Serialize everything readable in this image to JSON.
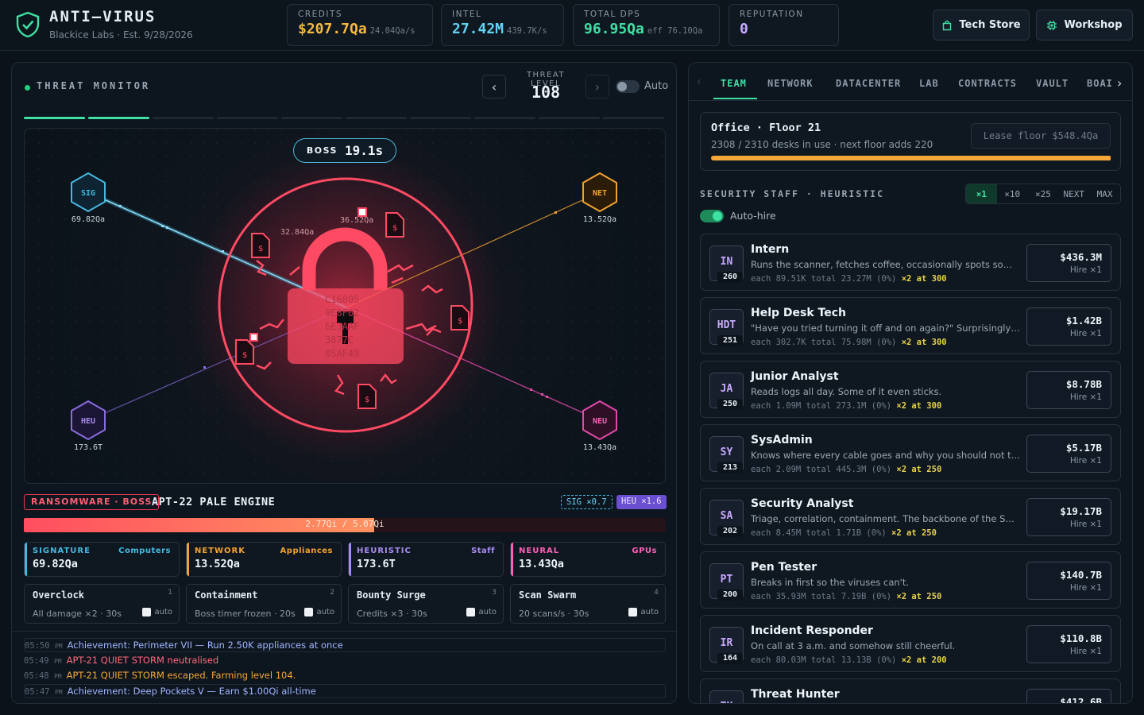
{
  "header": {
    "title": "ANTI–VIRUS",
    "subtitle": "Blackice Labs · Est. 9/28/2026",
    "stats": [
      {
        "label": "CREDITS",
        "value": "$207.7Qa",
        "rate": "24.04Qa/s",
        "color": "#f5b942"
      },
      {
        "label": "INTEL",
        "value": "27.42M",
        "rate": "439.7K/s",
        "color": "#64d2f2"
      },
      {
        "label": "TOTAL DPS",
        "value": "96.95Qa",
        "rate": "eff 76.10Qa",
        "color": "#3fe0a3"
      },
      {
        "label": "REPUTATION",
        "value": "0",
        "rate": "",
        "color": "#c8a8ff"
      }
    ],
    "buttons": {
      "tech_store": "Tech Store",
      "workshop": "Workshop"
    }
  },
  "threat": {
    "title": "THREAT MONITOR",
    "level_label": "THREAT LEVEL",
    "level": "108",
    "auto_label": "Auto",
    "progress_filled_segments": 2,
    "progress_total_segments": 10,
    "boss_label": "BOSS",
    "boss_timer": "19.1s",
    "damage_floaters": [
      "32.84Qa",
      "36.52Qa"
    ],
    "hex_nodes": [
      {
        "id": "SIG",
        "value": "69.82Qa",
        "color": "#46b8e0"
      },
      {
        "id": "NET",
        "value": "13.52Qa",
        "color": "#f2a230"
      },
      {
        "id": "HEU",
        "value": "173.6T",
        "color": "#8a6ce0"
      },
      {
        "id": "NEU",
        "value": "13.43Qa",
        "color": "#e04aa8"
      }
    ],
    "lock_hex": [
      "C16805",
      "9E8F02",
      "6E3AAF",
      "3877C",
      "05AF49"
    ],
    "enemy_tag": "RANSOMWARE · BOSS",
    "enemy_name": "APT-22 PALE ENGINE",
    "mult_sig": "SIG ×0.7",
    "mult_heu": "HEU ×1.6",
    "hp_text": "2.77Qi / 5.07Qi",
    "hp_fraction": 0.546
  },
  "damage_cards": [
    {
      "title": "SIGNATURE",
      "source": "Computers",
      "value": "69.82Qa",
      "color": "#46b8e0"
    },
    {
      "title": "NETWORK",
      "source": "Appliances",
      "value": "13.52Qa",
      "color": "#f2a230"
    },
    {
      "title": "HEURISTIC",
      "source": "Staff",
      "value": "173.6T",
      "color": "#a98cf0"
    },
    {
      "title": "NEURAL",
      "source": "GPUs",
      "value": "13.43Qa",
      "color": "#ff5fb8"
    }
  ],
  "abilities": [
    {
      "name": "Overclock",
      "key": "1",
      "desc": "All damage ×2 · 30s",
      "auto": "auto"
    },
    {
      "name": "Containment",
      "key": "2",
      "desc": "Boss timer frozen · 20s",
      "auto": "auto"
    },
    {
      "name": "Bounty Surge",
      "key": "3",
      "desc": "Credits ×3 · 30s",
      "auto": "auto"
    },
    {
      "name": "Scan Swarm",
      "key": "4",
      "desc": "20 scans/s · 30s",
      "auto": "auto"
    }
  ],
  "log": [
    {
      "time": "05:50",
      "ampm": "PM",
      "text": "Achievement: Perimeter VII — Run 2.50K appliances at once",
      "color": "#9fb6ff"
    },
    {
      "time": "05:49",
      "ampm": "PM",
      "text": "APT-21 QUIET STORM neutralised",
      "color": "#ff6b7e"
    },
    {
      "time": "05:48",
      "ampm": "PM",
      "text": "APT-21 QUIET STORM escaped. Farming level 104.",
      "color": "#f5a73a"
    },
    {
      "time": "05:47",
      "ampm": "PM",
      "text": "Achievement: Deep Pockets V — Earn $1.00Qi all-time",
      "color": "#9fb6ff"
    }
  ],
  "tabs": [
    "TEAM",
    "NETWORK",
    "DATACENTER",
    "LAB",
    "CONTRACTS",
    "VAULT",
    "BOAI"
  ],
  "office": {
    "title": "Office · Floor 21",
    "desc": "2308 / 2310 desks in use · next floor adds 220",
    "lease": "Lease floor $548.4Qa",
    "fill_fraction": 0.999
  },
  "staff_section": {
    "title": "SECURITY STAFF · HEURISTIC",
    "multipliers": [
      "×1",
      "×10",
      "×25",
      "NEXT",
      "MAX"
    ],
    "active_multiplier": 0,
    "autohire_label": "Auto-hire"
  },
  "staff": [
    {
      "badge": "IN",
      "count": "260",
      "name": "Intern",
      "desc": "Runs the scanner, fetches coffee, occasionally spots somet...",
      "each": "89.51K",
      "total": "23.27M",
      "pct": "(0%)",
      "next": "×2 at 300",
      "price": "$436.3M",
      "hire": "Hire ×1"
    },
    {
      "badge": "HDT",
      "count": "251",
      "name": "Help Desk Tech",
      "desc": "\"Have you tried turning it off and on again?\" Surprisingly eff...",
      "each": "302.7K",
      "total": "75.98M",
      "pct": "(0%)",
      "next": "×2 at 300",
      "price": "$1.42B",
      "hire": "Hire ×1"
    },
    {
      "badge": "JA",
      "count": "250",
      "name": "Junior Analyst",
      "desc": "Reads logs all day. Some of it even sticks.",
      "each": "1.09M",
      "total": "273.1M",
      "pct": "(0%)",
      "next": "×2 at 300",
      "price": "$8.78B",
      "hire": "Hire ×1"
    },
    {
      "badge": "SY",
      "count": "213",
      "name": "SysAdmin",
      "desc": "Knows where every cable goes and why you should not tou...",
      "each": "2.09M",
      "total": "445.3M",
      "pct": "(0%)",
      "next": "×2 at 250",
      "price": "$5.17B",
      "hire": "Hire ×1"
    },
    {
      "badge": "SA",
      "count": "202",
      "name": "Security Analyst",
      "desc": "Triage, correlation, containment. The backbone of the SOC.",
      "each": "8.45M",
      "total": "1.71B",
      "pct": "(0%)",
      "next": "×2 at 250",
      "price": "$19.17B",
      "hire": "Hire ×1"
    },
    {
      "badge": "PT",
      "count": "200",
      "name": "Pen Tester",
      "desc": "Breaks in first so the viruses can't.",
      "each": "35.93M",
      "total": "7.19B",
      "pct": "(0%)",
      "next": "×2 at 250",
      "price": "$140.7B",
      "hire": "Hire ×1"
    },
    {
      "badge": "IR",
      "count": "164",
      "name": "Incident Responder",
      "desc": "On call at 3 a.m. and somehow still cheerful.",
      "each": "80.03M",
      "total": "13.13B",
      "pct": "(0%)",
      "next": "×2 at 200",
      "price": "$110.8B",
      "hire": "Hire ×1"
    },
    {
      "badge": "TH",
      "count": "",
      "name": "Threat Hunter",
      "desc": "",
      "each": "",
      "total": "",
      "pct": "",
      "next": "",
      "price": "$412.6B",
      "hire": ""
    }
  ]
}
